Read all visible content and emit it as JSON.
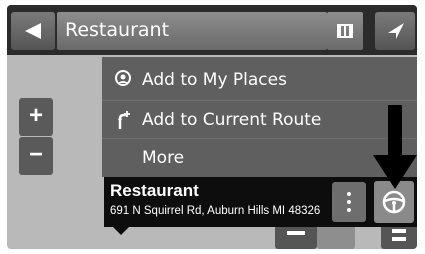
{
  "header": {
    "title": "Restaurant",
    "back_icon": "back-arrow-icon",
    "map_icon": "map-icon",
    "right_icon": "navigation-arrow-icon"
  },
  "zoom": {
    "in_label": "+",
    "out_label": "−"
  },
  "menu": {
    "items": [
      {
        "label": "Add to My Places",
        "icon": "place-pin-icon"
      },
      {
        "label": "Add to Current Route",
        "icon": "route-add-icon"
      },
      {
        "label": "More",
        "icon": ""
      }
    ]
  },
  "place": {
    "name": "Restaurant",
    "address": "691 N Squirrel Rd, Auburn Hills MI 48326",
    "more_icon": "more-vertical-icon",
    "drive_icon": "steering-wheel-icon"
  },
  "colors": {
    "topbar": "#2b2b2b",
    "menu_bg": "#5f5f5f",
    "panel_bg": "#0d0d0d",
    "map_bg": "#b9b9b9"
  }
}
